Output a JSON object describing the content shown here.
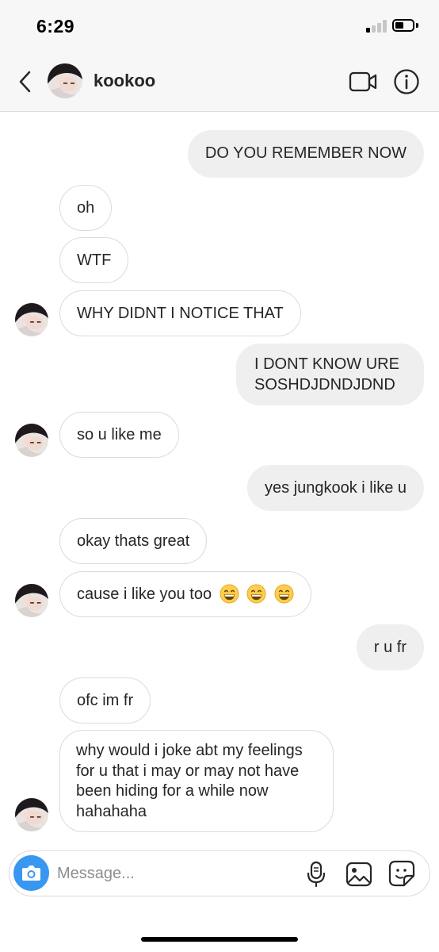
{
  "status_bar": {
    "time": "6:29"
  },
  "header": {
    "username": "kookoo"
  },
  "messages": [
    {
      "sender": "me",
      "text": "DO YOU REMEMBER NOW"
    },
    {
      "sender": "them",
      "text": "oh"
    },
    {
      "sender": "them",
      "text": "WTF"
    },
    {
      "sender": "them",
      "text": "WHY DIDNT I NOTICE THAT"
    },
    {
      "sender": "me",
      "text": "I DONT KNOW URE SOSHDJDNDJDND"
    },
    {
      "sender": "them",
      "text": "so u like me"
    },
    {
      "sender": "me",
      "text": "yes jungkook i like u"
    },
    {
      "sender": "them",
      "text": "okay thats great"
    },
    {
      "sender": "them",
      "text": "cause i like you too"
    },
    {
      "sender": "me",
      "text": "r u fr"
    },
    {
      "sender": "them",
      "text": "ofc im fr"
    },
    {
      "sender": "them",
      "text": "why would i joke abt my feelings for u that i may or may not have been hiding for a while now hahahaha"
    }
  ],
  "composer": {
    "placeholder": "Message..."
  },
  "colors": {
    "accent": "#3897f0",
    "outgoing_bubble": "#efefef",
    "incoming_border": "#dbdbdb"
  },
  "icons": [
    "back-icon",
    "video-call-icon",
    "info-icon",
    "camera-icon",
    "microphone-icon",
    "gallery-icon",
    "sticker-icon",
    "grinning-emoji"
  ]
}
